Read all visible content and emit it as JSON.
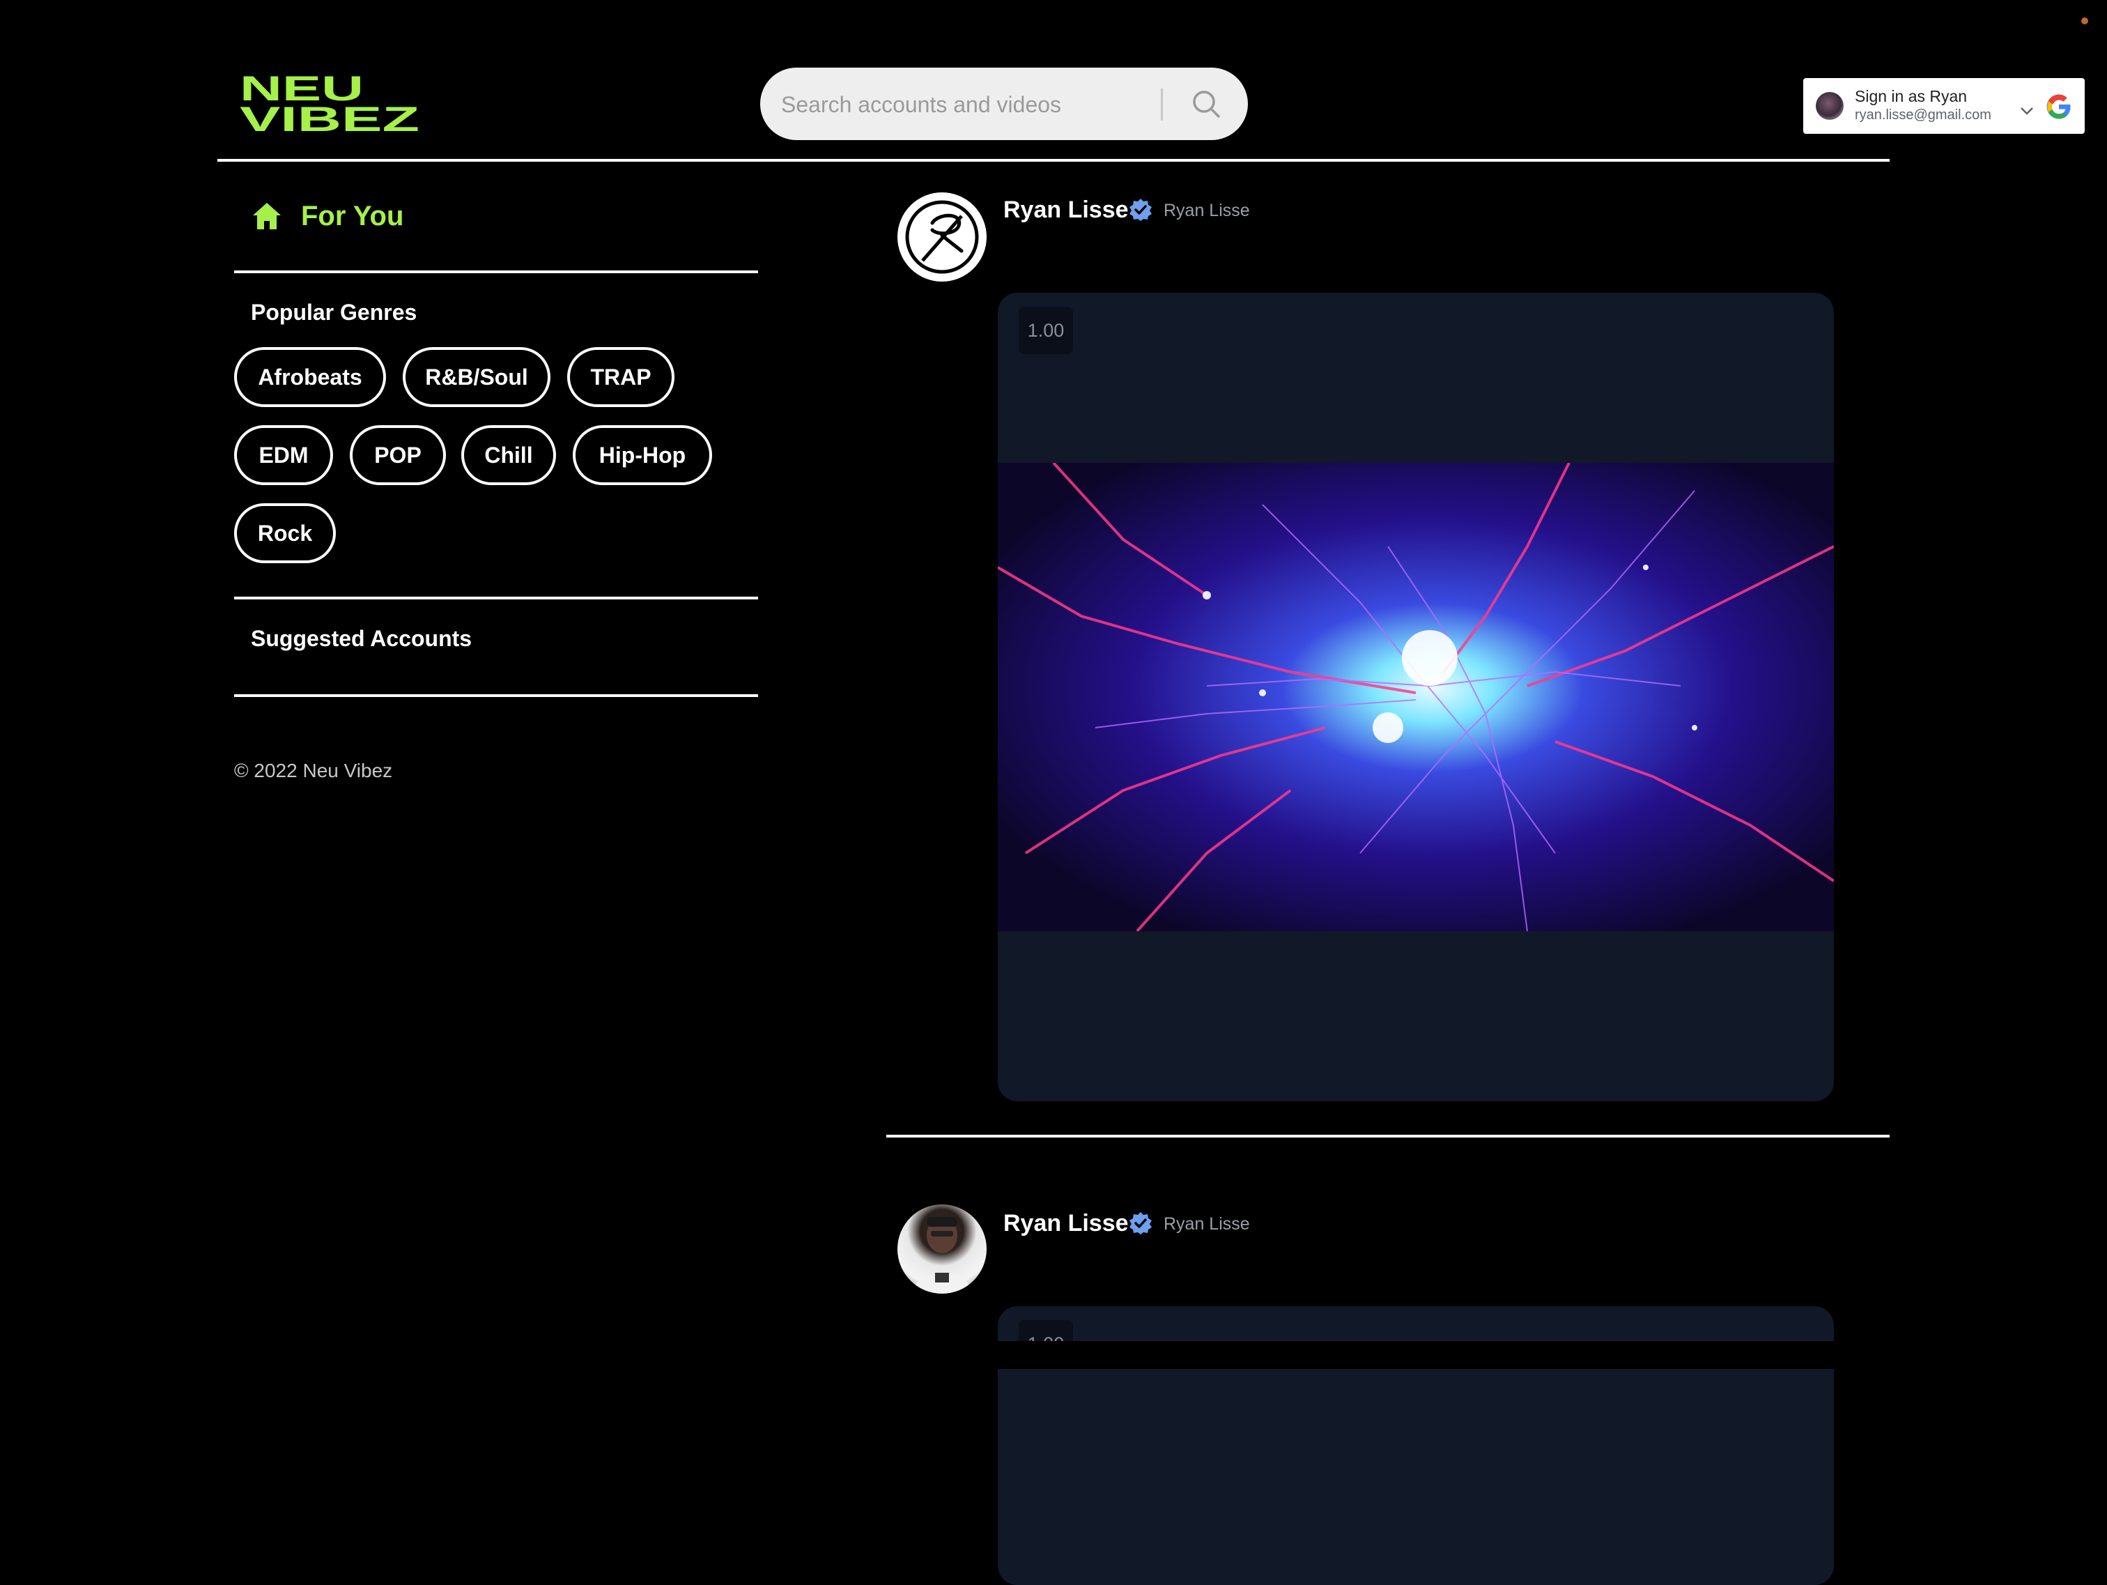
{
  "header": {
    "logo_line1": "NEU",
    "logo_line2": "VIBEZ",
    "search_placeholder": "Search accounts and videos",
    "signin": {
      "line1": "Sign in as Ryan",
      "line2": "ryan.lisse@gmail.com"
    }
  },
  "sidebar": {
    "for_you_label": "For You",
    "popular_genres_title": "Popular Genres",
    "genres": [
      "Afrobeats",
      "R&B/Soul",
      "TRAP",
      "EDM",
      "POP",
      "Chill",
      "Hip-Hop",
      "Rock"
    ],
    "suggested_accounts_title": "Suggested Accounts",
    "copyright": "© 2022 Neu Vibez"
  },
  "feed": {
    "posts": [
      {
        "name": "Ryan Lisse",
        "handle": "Ryan Lisse",
        "speed": "1.00"
      },
      {
        "name": "Ryan Lisse",
        "handle": "Ryan Lisse",
        "speed": "1.00"
      }
    ]
  },
  "colors": {
    "accent": "#a6f04a",
    "background": "#000000",
    "card": "#111827",
    "verified": "#6ea0f0"
  },
  "icons": [
    "home-icon",
    "search-icon",
    "chevron-down-icon",
    "google-icon",
    "verified-badge-icon"
  ]
}
